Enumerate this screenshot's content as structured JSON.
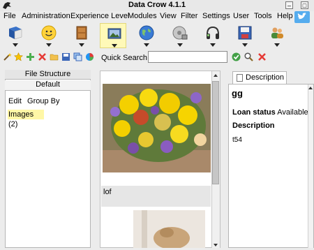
{
  "window": {
    "title": "Data Crow 4.1.1"
  },
  "menubar": {
    "items": [
      "File",
      "Administration",
      "Experience Level",
      "Modules",
      "View",
      "Filter",
      "Settings",
      "User",
      "Tools",
      "Help"
    ]
  },
  "toolbar_modules": [
    {
      "icon": "book-icon"
    },
    {
      "icon": "smiley-icon"
    },
    {
      "icon": "cabinet-icon"
    },
    {
      "icon": "image-icon",
      "active": true
    },
    {
      "icon": "globe-icon"
    },
    {
      "icon": "disc-drive-icon"
    },
    {
      "icon": "headphones-icon"
    },
    {
      "icon": "floppy-disk-icon"
    },
    {
      "icon": "users-icon"
    }
  ],
  "actionbar": {
    "quick_search_label": "Quick Search",
    "quick_search_value": ""
  },
  "left_panel": {
    "tab_file_structure": "File Structure",
    "tab_default": "Default",
    "menu_edit": "Edit",
    "menu_group_by": "Group By",
    "tree_item": "Images (2)"
  },
  "center_panel": {
    "caption": "lof"
  },
  "right_panel": {
    "tab_description": "Description",
    "item_title": "gg",
    "loan_status_label": "Loan status",
    "loan_status_value": "Available",
    "description_label": "Description",
    "description_value": "t54"
  },
  "colors": {
    "selection_yellow": "#fff7a6",
    "active_tab_yellow": "#fff9b8",
    "twitter_blue": "#55acee"
  }
}
